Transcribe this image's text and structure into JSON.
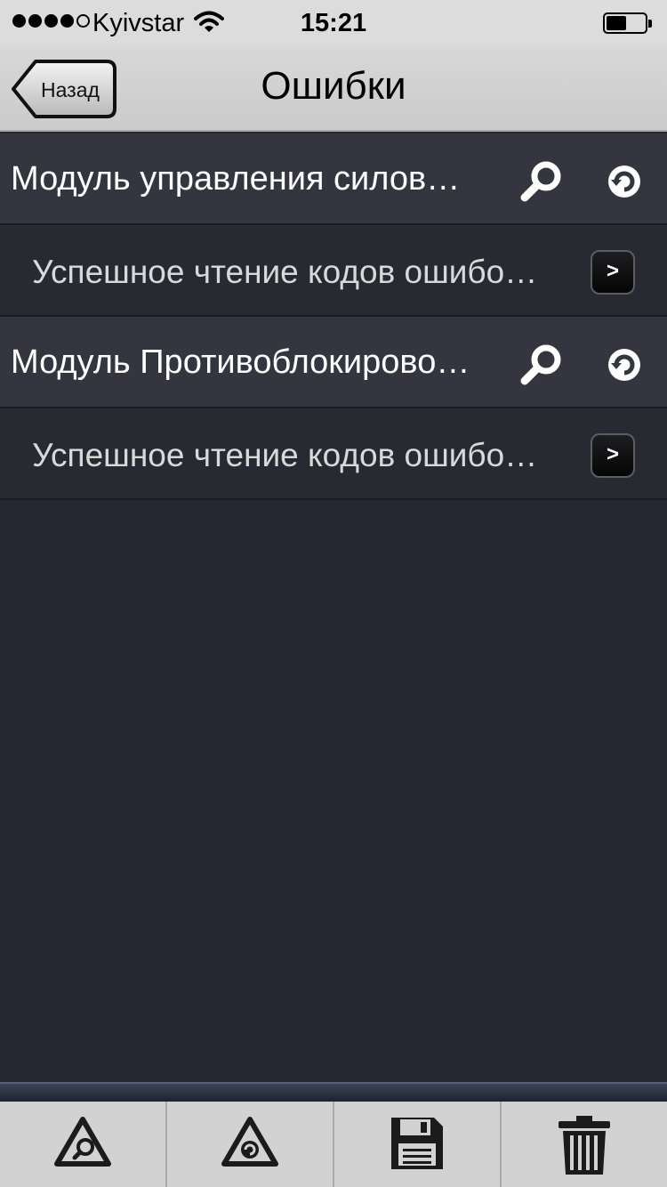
{
  "status_bar": {
    "carrier": "Kyivstar",
    "time": "15:21",
    "signal_bars_filled": 4,
    "signal_bars_total": 5
  },
  "nav": {
    "back_label": "Назад",
    "title": "Ошибки"
  },
  "modules": [
    {
      "title": "Модуль управления силов…",
      "result": "Успешное чтение кодов ошибо…"
    },
    {
      "title": "Модуль Противоблокирово…",
      "result": "Успешное чтение кодов ошибо…"
    }
  ],
  "toolbar": {
    "icons": [
      "search-warning-icon",
      "refresh-warning-icon",
      "save-icon",
      "trash-icon"
    ]
  },
  "colors": {
    "background": "#262730",
    "module_row": "#34353e",
    "result_row": "#282a31",
    "bar": "#d2d2d2"
  }
}
